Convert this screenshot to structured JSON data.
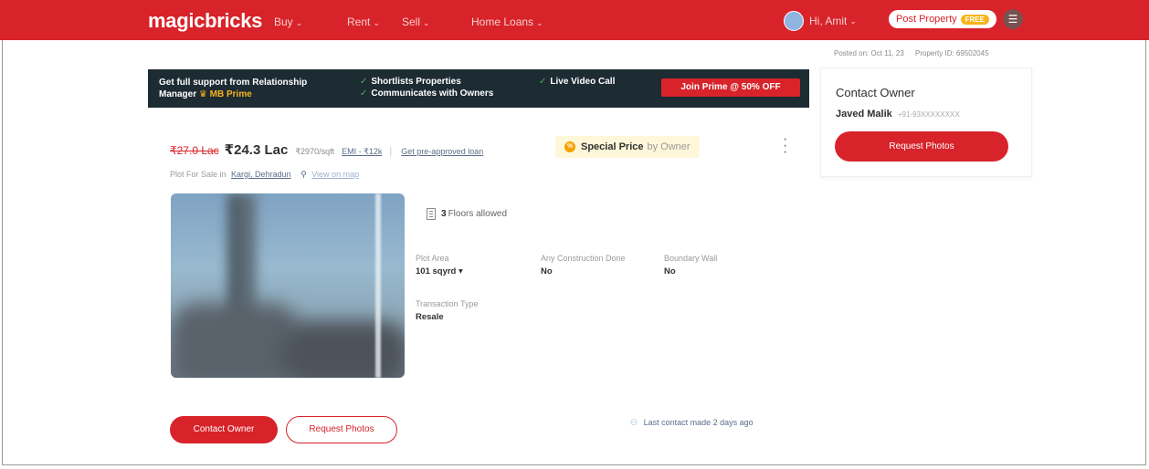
{
  "header": {
    "logo": "magicbricks",
    "nav": [
      {
        "label": "Buy"
      },
      {
        "label": "Rent"
      },
      {
        "label": "Sell"
      },
      {
        "label": "Home Loans"
      }
    ],
    "user_label": "Hi, Amit",
    "post_property_label": "Post Property",
    "post_property_badge": "FREE"
  },
  "meta": {
    "posted_on": "Posted on: Oct 11, 23",
    "property_id": "Property ID: 69502045"
  },
  "prime_banner": {
    "title_line1": "Get full support from Relationship",
    "title_line2_prefix": "Manager",
    "title_line2_accent": "MB Prime",
    "features": [
      "Shortlists Properties",
      "Communicates with Owners",
      "Live Video Call"
    ],
    "cta": "Join Prime @ 50% OFF"
  },
  "listing": {
    "old_price": "₹27.0 Lac",
    "price": "₹24.3 Lac",
    "rate": "₹2970/sqft",
    "emi_label": "EMI",
    "emi_value": "- ₹12k",
    "loan_link": "Get pre-approved loan",
    "special_label": "Special Price",
    "special_by": "by Owner",
    "subtitle_prefix": "Plot For Sale in",
    "location": "Kargi, Dehradun",
    "map_link": "View on map",
    "floors_count": "3",
    "floors_text": "Floors allowed",
    "specs": [
      {
        "label": "Plot Area",
        "value": "101 sqyrd ▾"
      },
      {
        "label": "Any Construction Done",
        "value": "No"
      },
      {
        "label": "Boundary Wall",
        "value": "No"
      },
      {
        "label": "Transaction Type",
        "value": "Resale"
      }
    ],
    "contact_button": "Contact Owner",
    "photos_button": "Request Photos",
    "last_contact": "Last contact made 2 days ago"
  },
  "owner_panel": {
    "title": "Contact Owner",
    "name": "Javed Malik",
    "phone": "+91-93XXXXXXXX",
    "button": "Request Photos"
  },
  "colors": {
    "brand_red": "#d8232a",
    "banner_dark": "#1d2b33",
    "accent_gold": "#f5b51b"
  },
  "icons": [
    "crown-icon",
    "check-icon",
    "location-pin-icon",
    "floors-icon",
    "special-price-icon",
    "more-options-icon",
    "person-icon",
    "menu-icon",
    "chevron-down-icon"
  ]
}
